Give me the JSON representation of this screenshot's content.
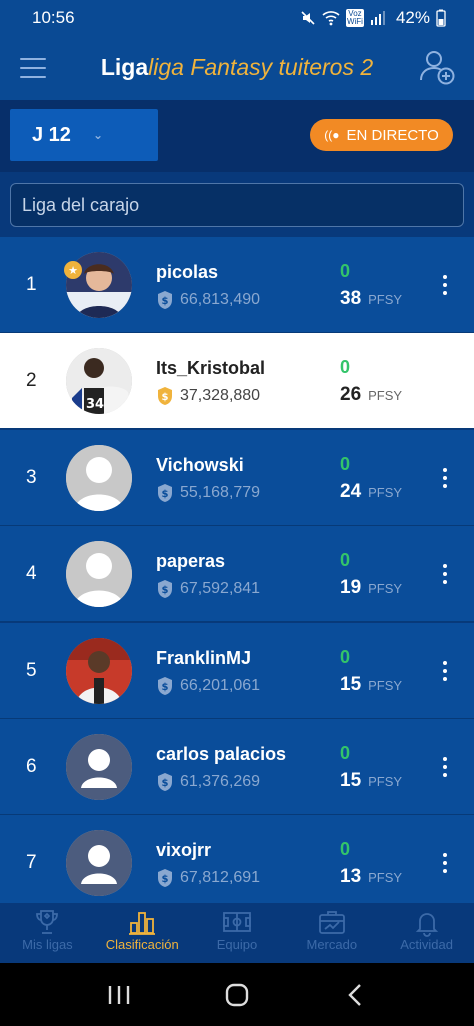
{
  "status": {
    "time": "10:56",
    "battery": "42%",
    "carrier": "Voz WiFi"
  },
  "header": {
    "title_prefix": "Liga",
    "title_league": "liga Fantasy tuiteros 2"
  },
  "round": {
    "label": "J 12"
  },
  "live": {
    "label": "EN DIRECTO"
  },
  "search": {
    "value": "Liga del carajo"
  },
  "units": {
    "points": "PFSY"
  },
  "colors": {
    "accent": "#f28a24",
    "brand_gold": "#f0b33c",
    "green": "#33c46a",
    "bg_blue": "#0a4d9a"
  },
  "standings": [
    {
      "rank": "1",
      "name": "picolas",
      "value": "66,813,490",
      "round_pts": "0",
      "total_pts": "38",
      "avatar": "photo-avatar",
      "is_me": false
    },
    {
      "rank": "2",
      "name": "Its_Kristobal",
      "value": "37,328,880",
      "round_pts": "0",
      "total_pts": "26",
      "avatar": "jersey-avatar",
      "is_me": true
    },
    {
      "rank": "3",
      "name": "Vichowski",
      "value": "55,168,779",
      "round_pts": "0",
      "total_pts": "24",
      "avatar": "default-avatar",
      "is_me": false
    },
    {
      "rank": "4",
      "name": "paperas",
      "value": "67,592,841",
      "round_pts": "0",
      "total_pts": "19",
      "avatar": "default-avatar",
      "is_me": false
    },
    {
      "rank": "5",
      "name": "FranklinMJ",
      "value": "66,201,061",
      "round_pts": "0",
      "total_pts": "15",
      "avatar": "player-avatar",
      "is_me": false
    },
    {
      "rank": "6",
      "name": "carlos palacios",
      "value": "61,376,269",
      "round_pts": "0",
      "total_pts": "15",
      "avatar": "placeholder-avatar",
      "is_me": false
    },
    {
      "rank": "7",
      "name": "vixojrr",
      "value": "67,812,691",
      "round_pts": "0",
      "total_pts": "13",
      "avatar": "placeholder-avatar",
      "is_me": false
    }
  ],
  "nav": [
    {
      "label": "Mis ligas",
      "icon": "trophy-icon",
      "active": false
    },
    {
      "label": "Clasificación",
      "icon": "bar-chart-icon",
      "active": true
    },
    {
      "label": "Equipo",
      "icon": "field-icon",
      "active": false
    },
    {
      "label": "Mercado",
      "icon": "market-icon",
      "active": false
    },
    {
      "label": "Actividad",
      "icon": "bell-icon",
      "active": false
    }
  ]
}
